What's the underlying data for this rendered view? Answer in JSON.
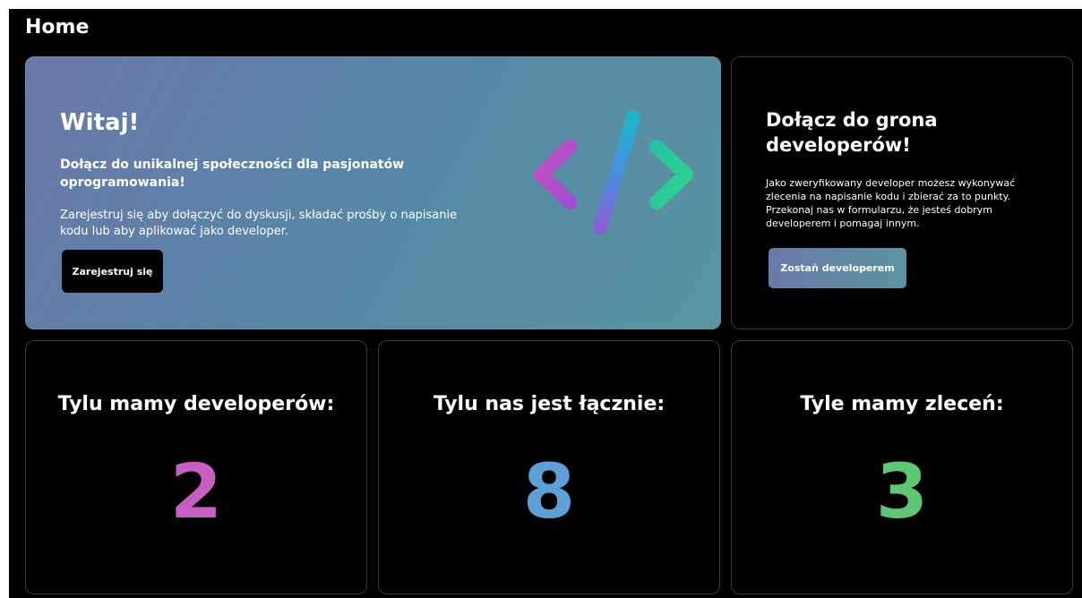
{
  "header": {
    "title": "Home"
  },
  "hero": {
    "title": "Witaj!",
    "subtitle": "Dołącz do unikalnej społeczności dla pasjonatów oprogramowania!",
    "text": "Zarejestruj się aby dołączyć do dyskusji, składać prośby o napisanie kodu lub aby aplikować jako developer.",
    "button_label": "Zarejestruj się",
    "icon": "code-icon"
  },
  "join": {
    "title": "Dołącz do grona developerów!",
    "text": "Jako zweryfikowany developer możesz wykonywać zlecenia na napisanie kodu i zbierać za to punkty. Przekonaj nas w formularzu, że jesteś dobrym developerem i pomagaj innym.",
    "button_label": "Zostań developerem"
  },
  "stats": [
    {
      "label": "Tylu mamy developerów:",
      "value": "2",
      "color": "#c85dc2"
    },
    {
      "label": "Tylu nas jest łącznie:",
      "value": "8",
      "color": "#5ea0d6"
    },
    {
      "label": "Tyle mamy zleceń:",
      "value": "3",
      "color": "#5fc676"
    }
  ],
  "colors": {
    "background": "#000000",
    "hero_gradient_start": "#6a78aa",
    "hero_gradient_end": "#5a95a0",
    "icon_purple": "#c24fc0",
    "icon_blue": "#4a8fe0",
    "icon_green": "#2ed48a"
  }
}
